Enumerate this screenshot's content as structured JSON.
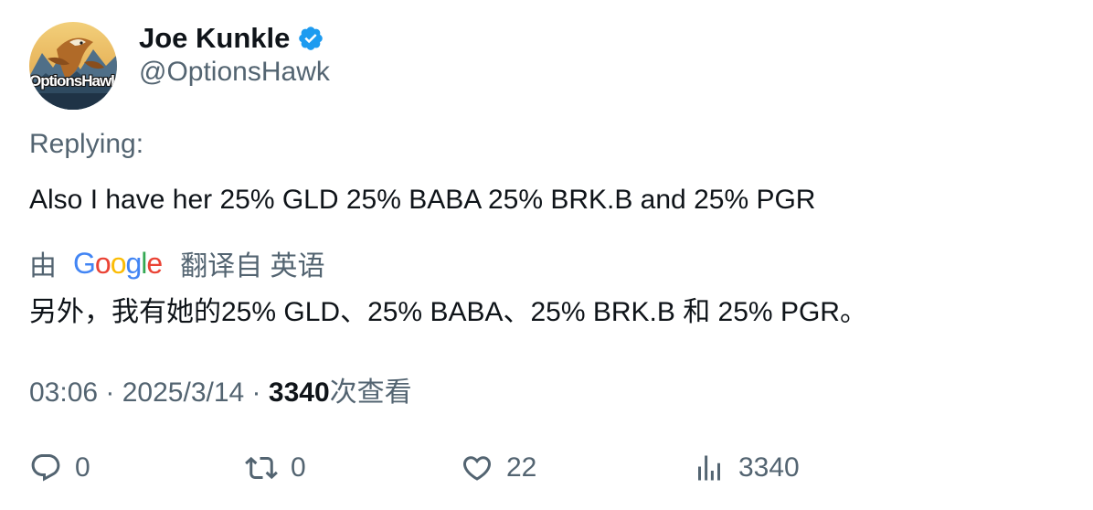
{
  "author": {
    "display_name": "Joe Kunkle",
    "handle": "@OptionsHawk",
    "avatar_text": "OptionsHawk",
    "verified_color": "#1d9bf0"
  },
  "tweet": {
    "replying_label": "Replying:",
    "text": "Also I have her 25% GLD 25% BABA 25% BRK.B and 25% PGR"
  },
  "translation": {
    "by_label": "由",
    "provider": "Google",
    "from_label": "翻译自 英语",
    "text": "另外，我有她的25% GLD、25% BABA、25% BRK.B 和 25% PGR。"
  },
  "meta": {
    "time": "03:06",
    "separator": " · ",
    "date": "2025/3/14",
    "views": "3340",
    "views_suffix": "次查看"
  },
  "actions": {
    "replies": "0",
    "reposts": "0",
    "likes": "22",
    "views": "3340"
  },
  "colors": {
    "text_primary": "#0f1419",
    "text_secondary": "#536471",
    "google_blue": "#4285F4",
    "google_red": "#EA4335",
    "google_yellow": "#FBBC05",
    "google_green": "#34A853"
  }
}
